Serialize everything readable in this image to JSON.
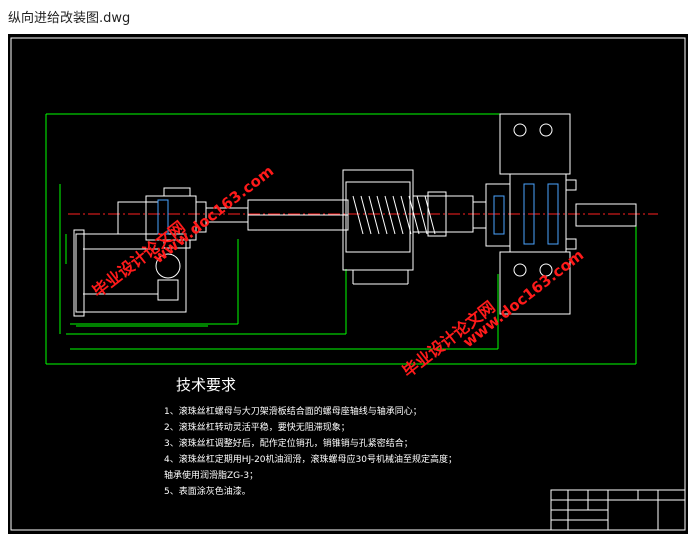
{
  "window": {
    "title": "纵向进给改装图.dwg"
  },
  "drawing": {
    "colors": {
      "background": "#000000",
      "outline": "#ffffff",
      "dimension": "#00ff00",
      "centerline": "#ff2020",
      "text": "#ffffff",
      "watermark": "#ff1a1a"
    },
    "tech_requirements": {
      "title": "技术要求",
      "items": [
        "1、滚珠丝杠螺母与大刀架滑板结合面的螺母座轴线与轴承同心；",
        "2、滚珠丝杠转动灵活平稳，要快无阻滞现象；",
        "3、滚珠丝杠调整好后，配作定位销孔，销锥销与孔紧密结合；",
        "4、滚珠丝杠定期用HJ-20机油润滑，滚珠螺母应30号机械油至规定高度；",
        "   轴承使用润滑脂ZG-3；",
        "5、表面涂灰色油漆。"
      ]
    },
    "watermarks": [
      "毕业设计论文网",
      "www.doc163.com"
    ]
  }
}
